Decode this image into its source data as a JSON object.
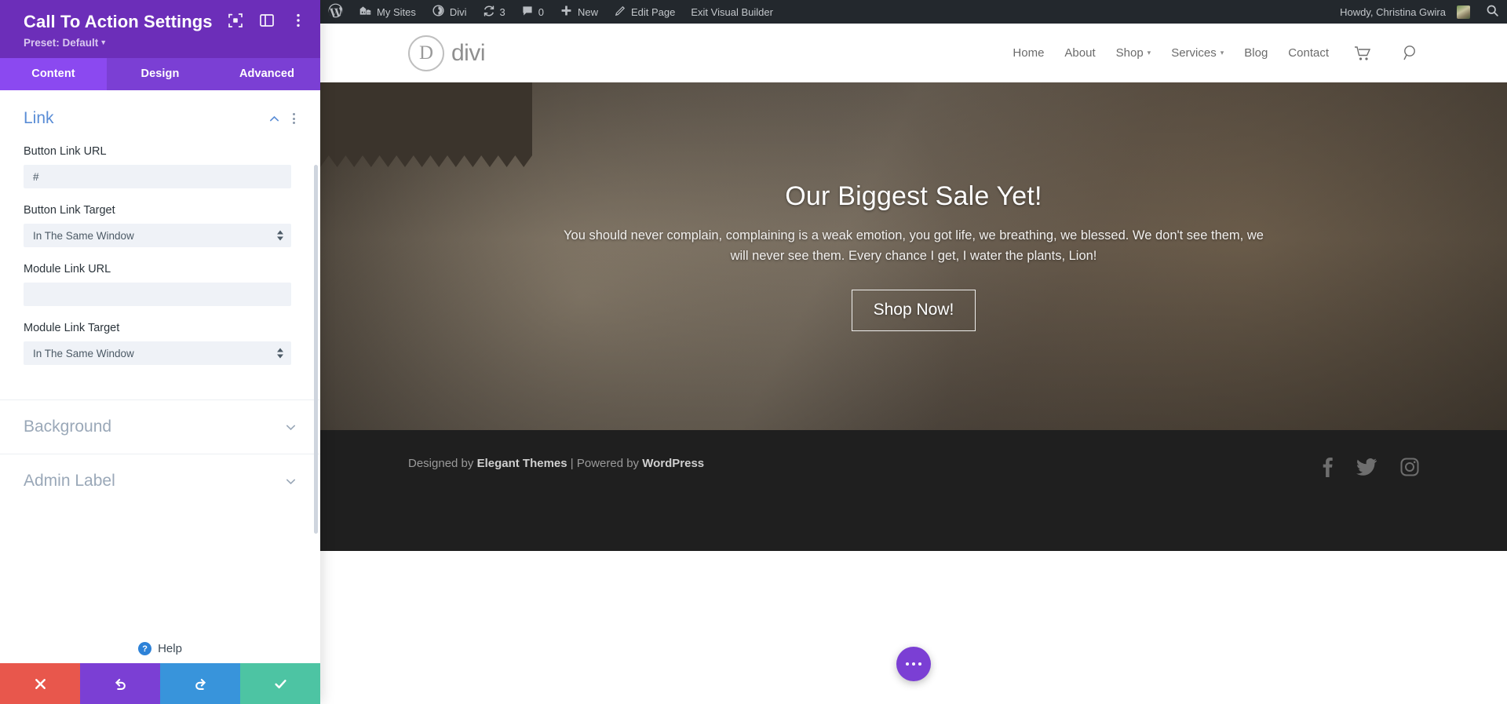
{
  "settings_panel": {
    "title": "Call To Action Settings",
    "preset_label": "Preset: Default",
    "header_icons": [
      "expand-icon",
      "layout-icon",
      "more-options-icon"
    ],
    "tabs": [
      {
        "label": "Content",
        "active": true
      },
      {
        "label": "Design",
        "active": false
      },
      {
        "label": "Advanced",
        "active": false
      }
    ],
    "open_section": {
      "title": "Link",
      "fields": [
        {
          "label": "Button Link URL",
          "type": "text",
          "value": "#",
          "placeholder": ""
        },
        {
          "label": "Button Link Target",
          "type": "select",
          "value": "In The Same Window"
        },
        {
          "label": "Module Link URL",
          "type": "text",
          "value": "",
          "placeholder": ""
        },
        {
          "label": "Module Link Target",
          "type": "select",
          "value": "In The Same Window"
        }
      ]
    },
    "collapsed_sections": [
      {
        "title": "Background"
      },
      {
        "title": "Admin Label"
      }
    ],
    "help": {
      "badge": "?",
      "label": "Help"
    },
    "actions": [
      {
        "name": "cancel",
        "icon": "close-icon",
        "color": "#e8574c"
      },
      {
        "name": "undo",
        "icon": "undo-icon",
        "color": "#7b3fd4"
      },
      {
        "name": "redo",
        "icon": "redo-icon",
        "color": "#3894db"
      },
      {
        "name": "save",
        "icon": "check-icon",
        "color": "#4dc4a3"
      }
    ]
  },
  "admin_bar": {
    "items": [
      {
        "label": "",
        "icon": "wordpress-logo-icon"
      },
      {
        "label": "My Sites",
        "icon": "sites-icon"
      },
      {
        "label": "Divi",
        "icon": "divi-icon"
      },
      {
        "label": "3",
        "icon": "updates-icon"
      },
      {
        "label": "0",
        "icon": "comments-icon"
      },
      {
        "label": "New",
        "icon": "plus-icon"
      },
      {
        "label": "Edit Page",
        "icon": "pencil-icon"
      },
      {
        "label": "Exit Visual Builder",
        "icon": ""
      }
    ],
    "howdy": "Howdy, Christina Gwira",
    "avatar": "user-avatar",
    "search_icon": "search-icon"
  },
  "site": {
    "logo_letter": "D",
    "logo_text": "divi",
    "nav": [
      {
        "label": "Home",
        "has_dropdown": false
      },
      {
        "label": "About",
        "has_dropdown": false
      },
      {
        "label": "Shop",
        "has_dropdown": true
      },
      {
        "label": "Services",
        "has_dropdown": true
      },
      {
        "label": "Blog",
        "has_dropdown": false
      },
      {
        "label": "Contact",
        "has_dropdown": false
      }
    ],
    "nav_icons": [
      "cart-icon",
      "search-icon"
    ],
    "hero": {
      "title": "Our Biggest Sale Yet!",
      "body": "You should never complain, complaining is a weak emotion, you got life, we breathing, we blessed. We don't see them, we will never see them. Every chance I get, I water the plants, Lion!",
      "button": "Shop Now!"
    },
    "footer": {
      "credit_prefix": "Designed by ",
      "credit_brand": "Elegant Themes",
      "credit_middle": " | Powered by ",
      "credit_brand2": "WordPress",
      "social": [
        "facebook-icon",
        "twitter-icon",
        "instagram-icon"
      ]
    },
    "fab": "more-options-fab"
  },
  "colors": {
    "panel_header": "#6c2eb9",
    "tab_active": "#8b49f0",
    "tab_bar": "#7b3fd4",
    "section_link": "#5a8dd6",
    "admin_bar": "#23282d",
    "footer_bg": "#1f1f1f"
  }
}
